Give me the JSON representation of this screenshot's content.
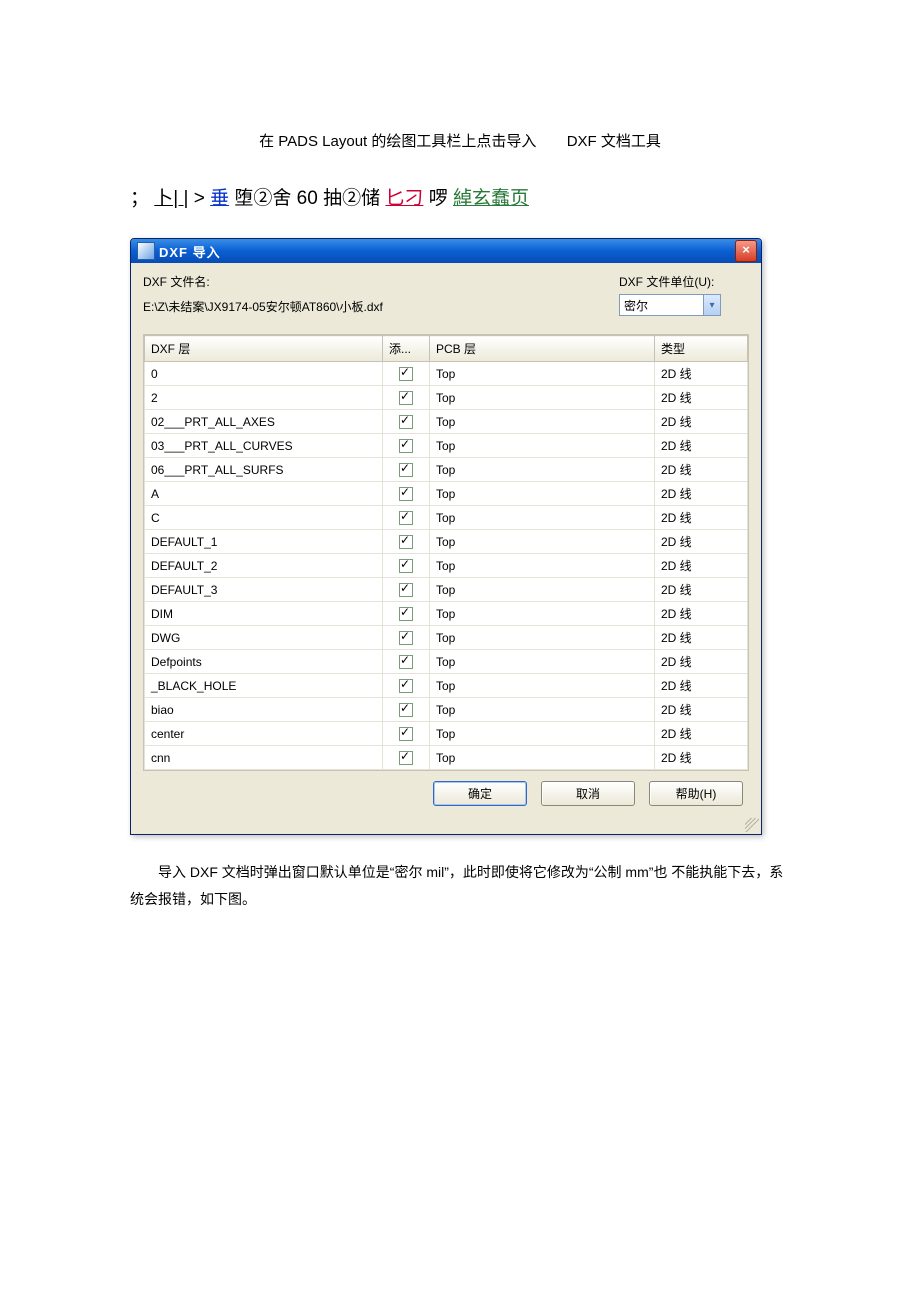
{
  "caption": {
    "part1": "在 PADS Layout 的绘图工具栏上点击导入",
    "part2": "DXF 文档工具"
  },
  "garbled": {
    "seg1": "；",
    "seg2": "卜| |",
    "seg3": " > ",
    "seg4": "垂",
    "seg5": "堕②舍 60 抽②储",
    "seg6": "匕刁",
    "seg7": "啰",
    "seg8": "綽玄蠢页"
  },
  "dialog": {
    "title": "DXF 导入",
    "close": "×",
    "filename_label": "DXF 文件名:",
    "filepath": "E:\\Z\\未结案\\JX9174-05安尔顿AT860\\小板.dxf",
    "unit_label": "DXF 文件单位(U):",
    "unit_value": "密尔",
    "headers": {
      "dxf": "DXF 层",
      "add": "添...",
      "pcb": "PCB 层",
      "type": "类型"
    },
    "rows": [
      {
        "dxf": "0",
        "pcb": "Top",
        "type": "2D 线"
      },
      {
        "dxf": "2",
        "pcb": "Top",
        "type": "2D 线"
      },
      {
        "dxf": "02___PRT_ALL_AXES",
        "pcb": "Top",
        "type": "2D 线"
      },
      {
        "dxf": "03___PRT_ALL_CURVES",
        "pcb": "Top",
        "type": "2D 线"
      },
      {
        "dxf": "06___PRT_ALL_SURFS",
        "pcb": "Top",
        "type": "2D 线"
      },
      {
        "dxf": "A",
        "pcb": "Top",
        "type": "2D 线"
      },
      {
        "dxf": "C",
        "pcb": "Top",
        "type": "2D 线"
      },
      {
        "dxf": "DEFAULT_1",
        "pcb": "Top",
        "type": "2D 线"
      },
      {
        "dxf": "DEFAULT_2",
        "pcb": "Top",
        "type": "2D 线"
      },
      {
        "dxf": "DEFAULT_3",
        "pcb": "Top",
        "type": "2D 线"
      },
      {
        "dxf": "DIM",
        "pcb": "Top",
        "type": "2D 线"
      },
      {
        "dxf": "DWG",
        "pcb": "Top",
        "type": "2D 线"
      },
      {
        "dxf": "Defpoints",
        "pcb": "Top",
        "type": "2D 线"
      },
      {
        "dxf": "_BLACK_HOLE",
        "pcb": "Top",
        "type": "2D 线"
      },
      {
        "dxf": "biao",
        "pcb": "Top",
        "type": "2D 线"
      },
      {
        "dxf": "center",
        "pcb": "Top",
        "type": "2D 线"
      },
      {
        "dxf": "cnn",
        "pcb": "Top",
        "type": "2D 线"
      }
    ],
    "buttons": {
      "ok": "确定",
      "cancel": "取消",
      "help": "帮助(H)"
    }
  },
  "body_text": "导入 DXF 文档时弹出窗口默认单位是“密尔 mil”，此时即使将它修改为“公制 mm”也 不能执能下去，系统会报错，如下图。"
}
